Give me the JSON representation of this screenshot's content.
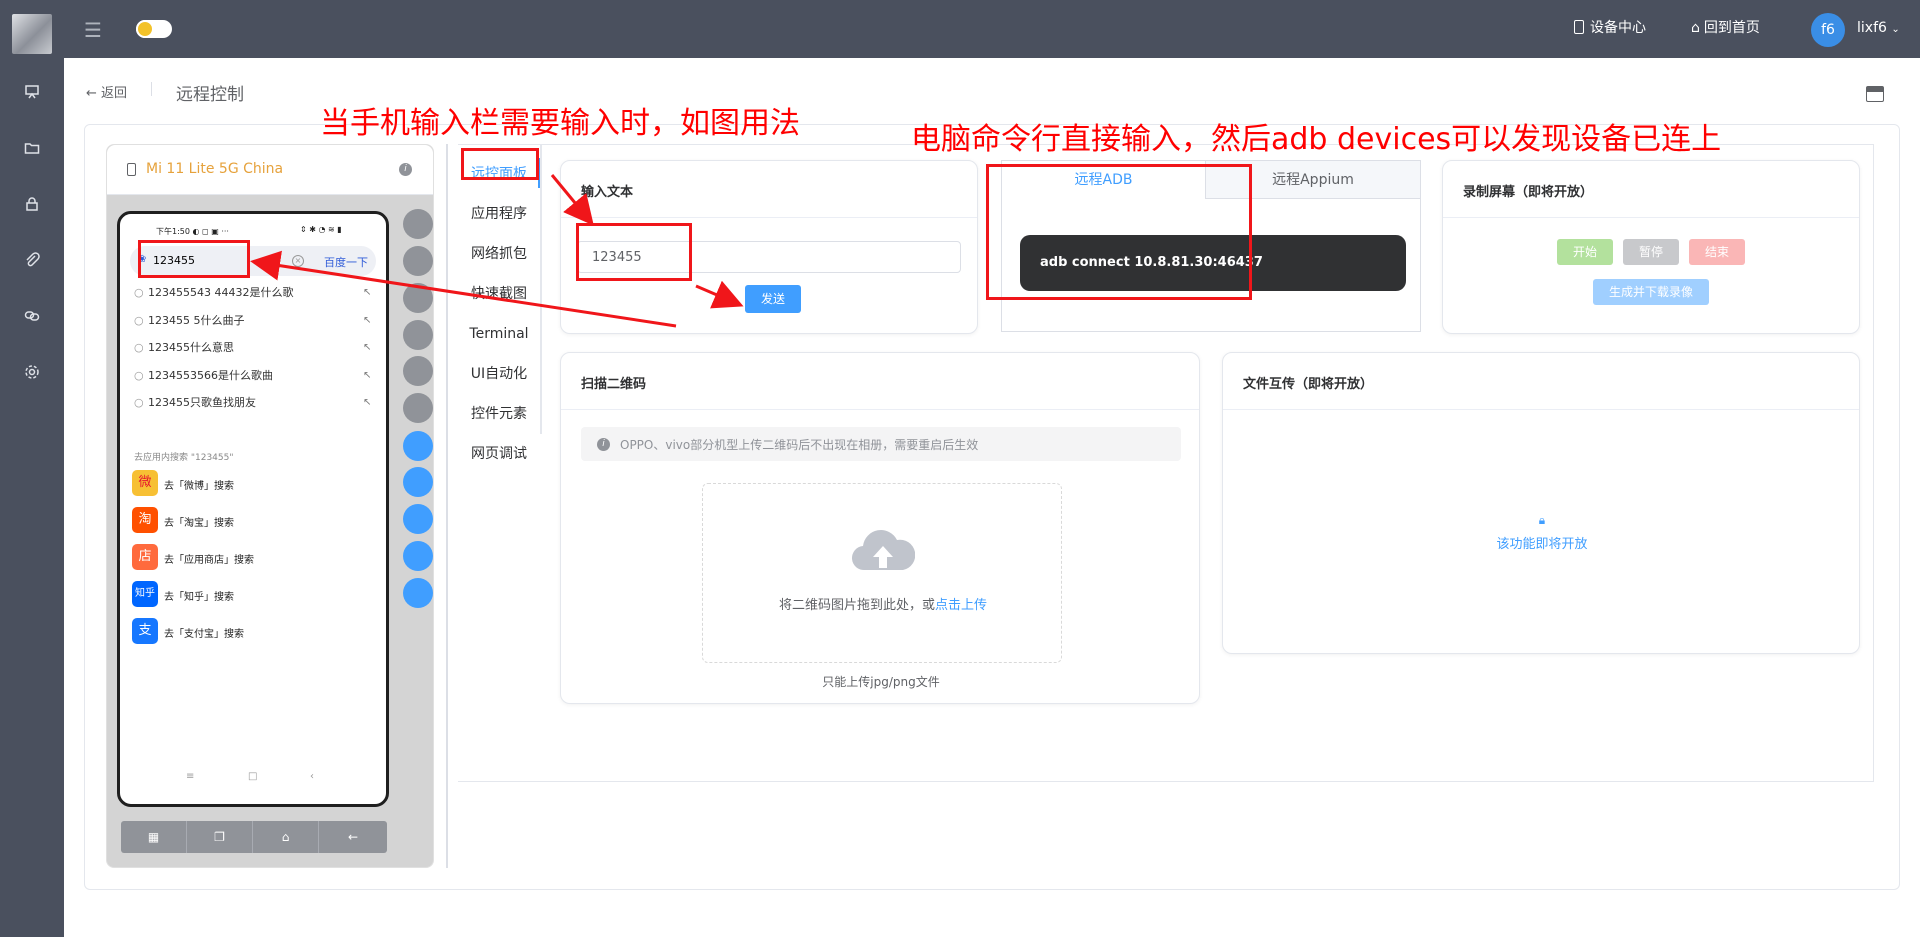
{
  "topbar": {
    "device_center": "设备中心",
    "back_home": "回到首页",
    "avatar": "f6",
    "username": "lixf6"
  },
  "sidebar": {
    "icons": [
      "presentation-icon",
      "folder-icon",
      "lock-icon",
      "paperclip-icon",
      "link-icon",
      "gear-icon"
    ]
  },
  "header": {
    "back": "返回",
    "title": "远程控制"
  },
  "phone": {
    "device_name": "Mi 11 Lite 5G China",
    "status_time": "下午1:50",
    "search_value": "123455",
    "search_button": "百度一下",
    "suggestions": [
      "123455543 44432是什么歌",
      "123455 5什么曲子",
      "123455什么意思",
      "1234553566是什么歌曲",
      "123455只歌鱼找朋友"
    ],
    "in_app_hint": "去应用内搜索 \"123455\"",
    "apps": [
      {
        "badge": "微",
        "label": "去「微博」搜索"
      },
      {
        "badge": "淘",
        "label": "去「淘宝」搜索"
      },
      {
        "badge": "店",
        "label": "去「应用商店」搜索"
      },
      {
        "badge": "知乎",
        "label": "去「知乎」搜索"
      },
      {
        "badge": "支",
        "label": "去「支付宝」搜索"
      }
    ]
  },
  "remote_menu": [
    "远控面板",
    "应用程序",
    "网络抓包",
    "快速截图",
    "Terminal",
    "UI自动化",
    "控件元素",
    "网页调试"
  ],
  "input_text": {
    "title": "输入文本",
    "value": "123455",
    "send": "发送"
  },
  "adb": {
    "tab_adb": "远程ADB",
    "tab_appium": "远程Appium",
    "command": "adb connect 10.8.81.30:46437"
  },
  "record": {
    "title": "录制屏幕（即将开放）",
    "start": "开始",
    "pause": "暂停",
    "stop": "结束",
    "download": "生成并下载录像"
  },
  "qr": {
    "title": "扫描二维码",
    "notice": "OPPO、vivo部分机型上传二维码后不出现在相册，需要重启后生效",
    "drag_text": "将二维码图片拖到此处，或",
    "click_upload": "点击上传",
    "tip": "只能上传jpg/png文件"
  },
  "file": {
    "title": "文件互传（即将开放）",
    "coming": "该功能即将开放"
  },
  "annotations": {
    "left": "当手机输入栏需要输入时，如图用法",
    "right": "电脑命令行直接输入，然后adb devices可以发现设备已连上"
  }
}
